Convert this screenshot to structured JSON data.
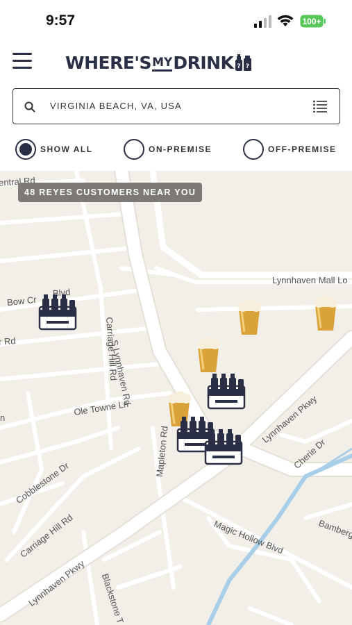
{
  "status_bar": {
    "time": "9:57",
    "battery": "100+"
  },
  "header": {
    "logo_where": "WHERE'S",
    "logo_my": "MY",
    "logo_drink": "DRINK",
    "menu_icon": "hamburger-icon"
  },
  "search": {
    "value": "VIRGINIA BEACH, VA, USA",
    "search_icon": "search-icon",
    "list_icon": "list-icon"
  },
  "filters": [
    {
      "label": "SHOW ALL",
      "selected": true
    },
    {
      "label": "ON-PREMISE",
      "selected": false
    },
    {
      "label": "OFF-PREMISE",
      "selected": false
    }
  ],
  "map": {
    "badge": "48 REYES CUSTOMERS NEAR YOU",
    "road_labels": [
      "entral Rd",
      "Lynnhaven Mall Lo",
      "Bow Cr",
      "Blvd",
      "r Rd",
      "S Lynnhaven Rd",
      "Carriage Hill Rd",
      "Ole Towne Ln",
      "Lynnhaven Pkwy",
      "Cherie Dr",
      "Mapleton Rd",
      "n",
      "Cobblestone Dr",
      "Carriage Hill Rd",
      "Magic Hollow Blvd",
      "Bamberg",
      "Lynnhaven Pkwy",
      "Blackstone T"
    ],
    "markers": [
      {
        "type": "off-premise",
        "icon": "six-pack-icon"
      },
      {
        "type": "on-premise",
        "icon": "beer-glass-icon"
      },
      {
        "type": "on-premise",
        "icon": "beer-glass-icon"
      },
      {
        "type": "on-premise",
        "icon": "beer-glass-icon"
      },
      {
        "type": "off-premise",
        "icon": "six-pack-icon"
      },
      {
        "type": "on-premise",
        "icon": "beer-glass-icon"
      },
      {
        "type": "off-premise",
        "icon": "six-pack-icon"
      },
      {
        "type": "off-premise",
        "icon": "six-pack-icon"
      }
    ]
  },
  "colors": {
    "brand_navy": "#2a2f45",
    "beer_gold": "#d9a33a",
    "map_bg": "#f2efe9",
    "water": "#a9cfe8"
  }
}
